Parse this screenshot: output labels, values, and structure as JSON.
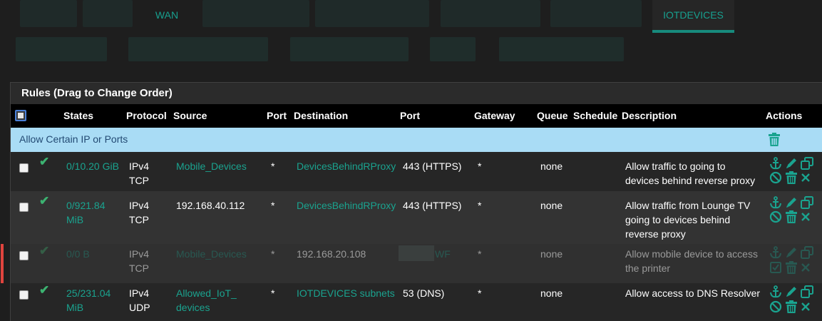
{
  "tabs": {
    "wan_label": "WAN",
    "iot_label": "IOTDEVICES"
  },
  "panel": {
    "title": "Rules (Drag to Change Order)"
  },
  "columns": {
    "states": "States",
    "protocol": "Protocol",
    "source": "Source",
    "port": "Port",
    "destination": "Destination",
    "port2": "Port",
    "gateway": "Gateway",
    "queue": "Queue",
    "schedule": "Schedule",
    "description": "Description",
    "actions": "Actions"
  },
  "separator": {
    "label": "Allow Certain IP or Ports"
  },
  "rows": [
    {
      "states_1": "0/10.20 GiB",
      "states_2": "",
      "proto_1": "IPv4",
      "proto_2": "TCP",
      "source_1": "Mobile_Devices",
      "source_2": "",
      "sport": "*",
      "dest": "DevicesBehindRProxy",
      "dport": "443 (HTTPS)",
      "gateway": "*",
      "queue": "none",
      "desc_1": "Allow traffic to going to",
      "desc_2": "devices behind reverse proxy",
      "desc_3": ""
    },
    {
      "states_1": "0/921.84",
      "states_2": "MiB",
      "proto_1": "IPv4",
      "proto_2": "TCP",
      "source_1": "192.168.40.112",
      "source_2": "",
      "sport": "*",
      "dest": "DevicesBehindRProxy",
      "dport": "443 (HTTPS)",
      "gateway": "*",
      "queue": "none",
      "desc_1": "Allow traffic from Lounge TV",
      "desc_2": "going to devices behind",
      "desc_3": "reverse proxy"
    },
    {
      "states_1": "0/0 B",
      "states_2": "",
      "proto_1": "IPv4",
      "proto_2": "TCP",
      "source_1": "Mobile_Devices",
      "source_2": "",
      "sport": "*",
      "dest": "192.168.20.108",
      "dport": "WF",
      "gateway": "*",
      "queue": "none",
      "desc_1": "Allow mobile device to access",
      "desc_2": "the printer",
      "desc_3": ""
    },
    {
      "states_1": "25/231.04",
      "states_2": "MiB",
      "proto_1": "IPv4",
      "proto_2": "UDP",
      "source_1": "Allowed_IoT_",
      "source_2": "devices",
      "sport": "*",
      "dest": "IOTDEVICES subnets",
      "dport": "53 (DNS)",
      "gateway": "*",
      "queue": "none",
      "desc_1": "Allow access to DNS Resolver",
      "desc_2": "",
      "desc_3": ""
    }
  ],
  "colors": {
    "accent": "#1aa38f",
    "separator_bg": "#a9dcf5",
    "disabled_marker": "#e0443e"
  }
}
